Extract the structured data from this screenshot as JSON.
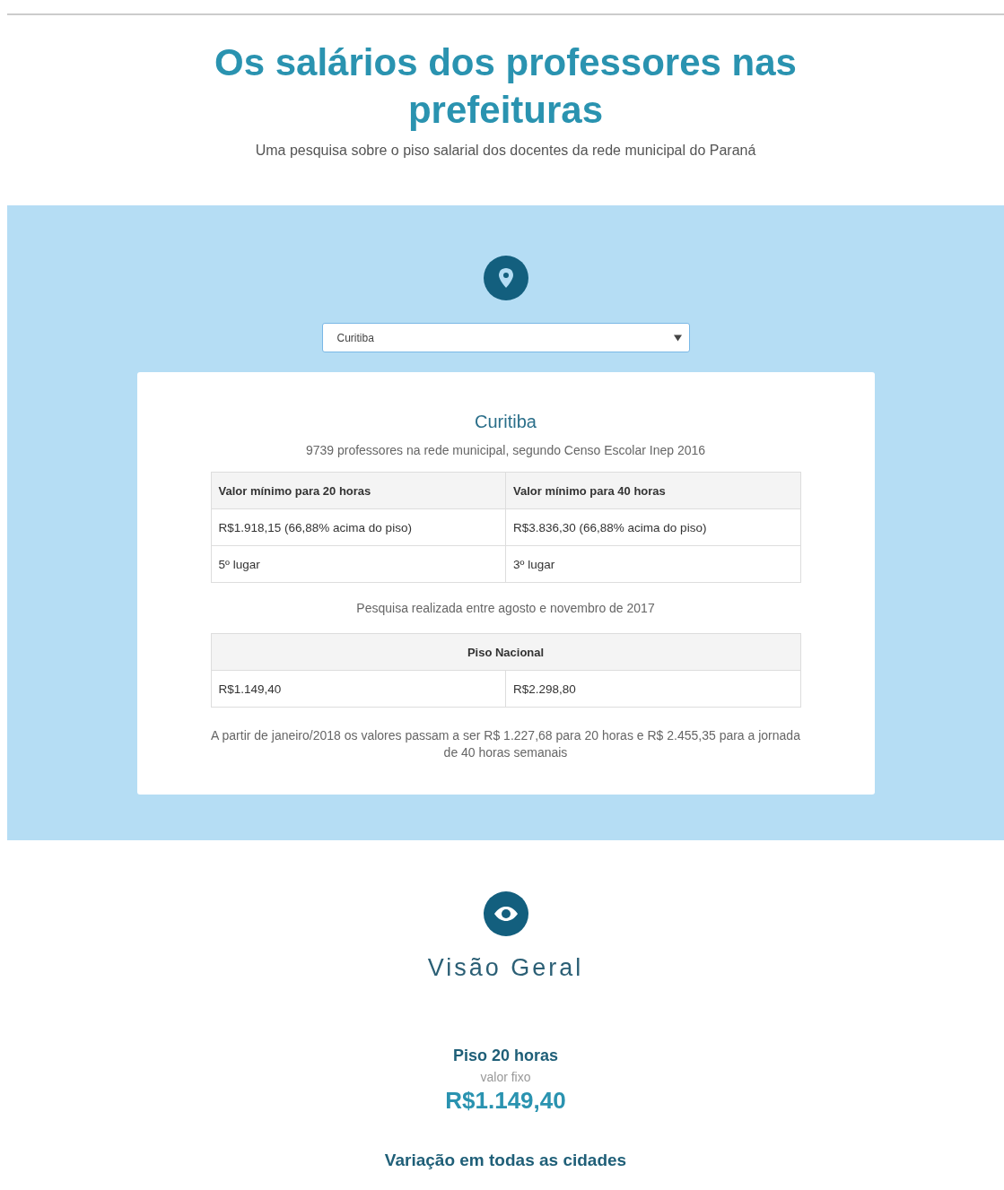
{
  "header": {
    "title": "Os salários dos professores nas prefeituras",
    "subtitle": "Uma pesquisa sobre o piso salarial dos docentes da rede municipal do Paraná"
  },
  "city_select": {
    "value": "Curitiba"
  },
  "city_card": {
    "name": "Curitiba",
    "teachers": "9739 professores na rede municipal, segundo Censo Escolar Inep 2016",
    "salary_table": {
      "columns": [
        "Valor mínimo para 20 horas",
        "Valor mínimo para 40 horas"
      ],
      "rows": [
        [
          "R$1.918,15 (66,88% acima do piso)",
          "R$3.836,30 (66,88% acima do piso)"
        ],
        [
          "5º lugar",
          "3º lugar"
        ]
      ]
    },
    "survey_note": "Pesquisa realizada entre agosto e novembro de 2017",
    "national_table": {
      "heading": "Piso Nacional",
      "rows": [
        [
          "R$1.149,40",
          "R$2.298,80"
        ]
      ]
    },
    "footnote": "A partir de janeiro/2018 os valores passam a ser R$ 1.227,68 para 20 horas e R$ 2.455,35 para a jornada de 40 horas semanais"
  },
  "overview": {
    "title": "Visão Geral",
    "floor_label": "Piso 20 horas",
    "floor_sublabel": "valor fixo",
    "floor_value": "R$1.149,40",
    "variation_heading": "Variação em todas as cidades"
  }
}
